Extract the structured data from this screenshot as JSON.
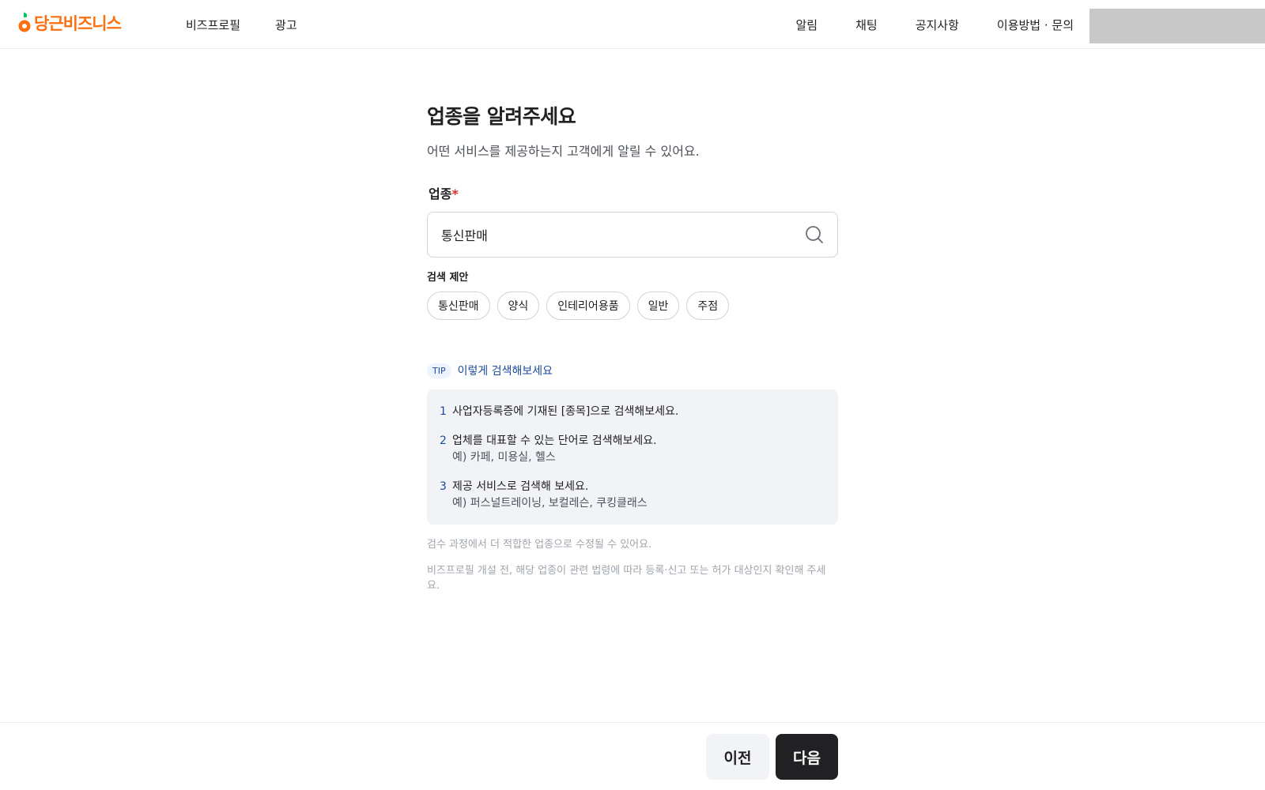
{
  "header": {
    "logo_text": "당근비즈니스",
    "nav_left": [
      "비즈프로필",
      "광고"
    ],
    "nav_right": [
      "알림",
      "채팅",
      "공지사항",
      "이용방법 · 문의"
    ]
  },
  "main": {
    "title": "업종을 알려주세요",
    "subtitle": "어떤 서비스를 제공하는지 고객에게 알릴 수 있어요.",
    "field_label": "업종",
    "required_mark": "*",
    "search_value": "통신판매",
    "suggest_title": "검색 제안",
    "suggestions": [
      "통신판매",
      "양식",
      "인테리어용품",
      "일반",
      "주점"
    ],
    "tip_badge": "TIP",
    "tip_title": "이렇게 검색해보세요",
    "tips": [
      {
        "num": "1",
        "text": "사업자등록증에 기재된 [종목]으로 검색해보세요.",
        "example": ""
      },
      {
        "num": "2",
        "text": "업체를 대표할 수 있는 단어로 검색해보세요.",
        "example": "예) 카페, 미용실, 헬스"
      },
      {
        "num": "3",
        "text": "제공 서비스로 검색해 보세요.",
        "example": "예) 퍼스널트레이닝, 보컬레슨, 쿠킹클래스"
      }
    ],
    "notice_1": "검수 과정에서 더 적합한 업종으로 수정될 수 있어요.",
    "notice_2": "비즈프로필 개설 전, 해당 업종이 관련 법령에 따라 등록·신고 또는 허가 대상인지 확인해 주세요."
  },
  "footer": {
    "prev_label": "이전",
    "next_label": "다음"
  },
  "colors": {
    "brand": "#ff6f0f",
    "tip_accent": "#1d4a9c",
    "primary_button": "#212124"
  }
}
